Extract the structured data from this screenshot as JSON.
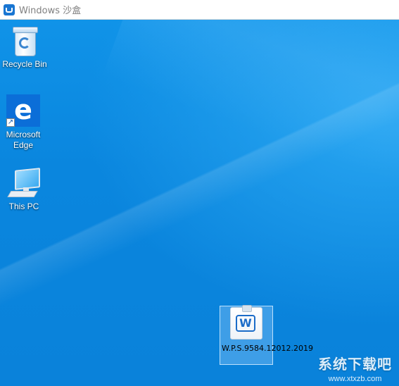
{
  "window": {
    "title": "Windows 沙盒"
  },
  "desktop": {
    "icons": [
      {
        "label": "Recycle Bin"
      },
      {
        "label": "Microsoft Edge"
      },
      {
        "label": "This PC"
      },
      {
        "label": "W.P.S.9584.12012.2019"
      }
    ]
  },
  "edge_glyph": "e",
  "wps_glyph": "W",
  "shortcut_glyph": "↗",
  "watermark": {
    "text": "系统下载吧",
    "url": "www.xtxzb.com"
  },
  "colors": {
    "desktop_blue": "#0f8de6",
    "edge_tile": "#0b6ed8",
    "wps_blue": "#1b6cc8"
  },
  "icons_semantic": [
    "recycle-bin-icon",
    "edge-icon",
    "this-pc-icon",
    "wps-installer-icon",
    "sandbox-icon"
  ]
}
